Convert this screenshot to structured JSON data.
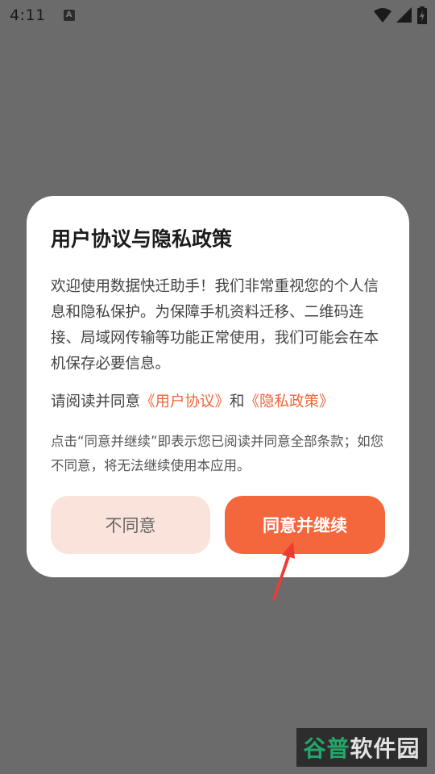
{
  "status_bar": {
    "time": "4:11",
    "icons": [
      "a-icon",
      "wifi-icon",
      "signal-icon",
      "battery-charging-icon"
    ]
  },
  "dialog": {
    "title": "用户协议与隐私政策",
    "body": "欢迎使用数据快迁助手！我们非常重视您的个人信息和隐私保护。为保障手机资料迁移、二维码连接、局域网传输等功能正常使用，我们可能会在本机保存必要信息。",
    "prompt_prefix": "请阅读并同意",
    "user_agreement_link": "《用户协议》",
    "prompt_and": "和",
    "privacy_policy_link": "《隐私政策》",
    "note": "点击“同意并继续”即表示您已阅读并同意全部条款；如您不同意，将无法继续使用本应用。",
    "disagree_label": "不同意",
    "agree_label": "同意并继续"
  },
  "watermark": {
    "part1": "谷普",
    "part2": "软件园"
  },
  "colors": {
    "accent": "#f4663b",
    "link": "#f0653b",
    "disagree_bg": "#fae3da",
    "overlay": "#6b6b6b"
  }
}
